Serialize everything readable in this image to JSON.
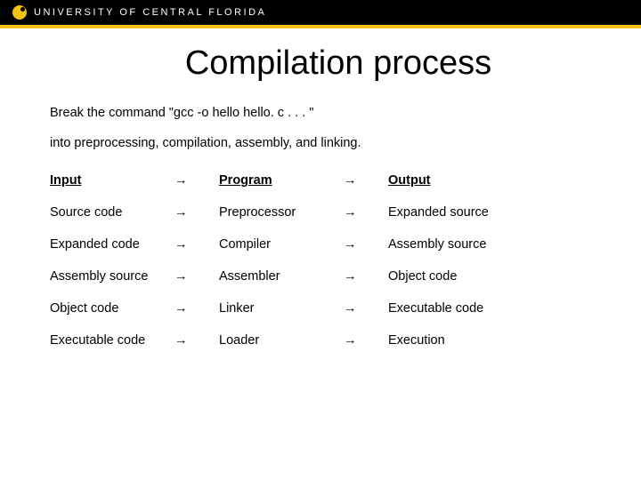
{
  "header": {
    "university": "UNIVERSITY OF CENTRAL FLORIDA"
  },
  "title": "Compilation process",
  "intro_line1": "Break the command \"gcc -o hello hello. c . . . \"",
  "intro_line2": "into preprocessing, compilation, assembly, and linking.",
  "table": {
    "arrow": "→",
    "header": {
      "input": "Input",
      "program": "Program",
      "output": "Output"
    },
    "rows": [
      {
        "input": "Source code",
        "program": "Preprocessor",
        "output": "Expanded source"
      },
      {
        "input": "Expanded code",
        "program": "Compiler",
        "output": "Assembly source"
      },
      {
        "input": "Assembly source",
        "program": "Assembler",
        "output": "Object code"
      },
      {
        "input": "Object code",
        "program": "Linker",
        "output": "Executable code"
      },
      {
        "input": "Executable code",
        "program": "Loader",
        "output": "Execution"
      }
    ]
  }
}
